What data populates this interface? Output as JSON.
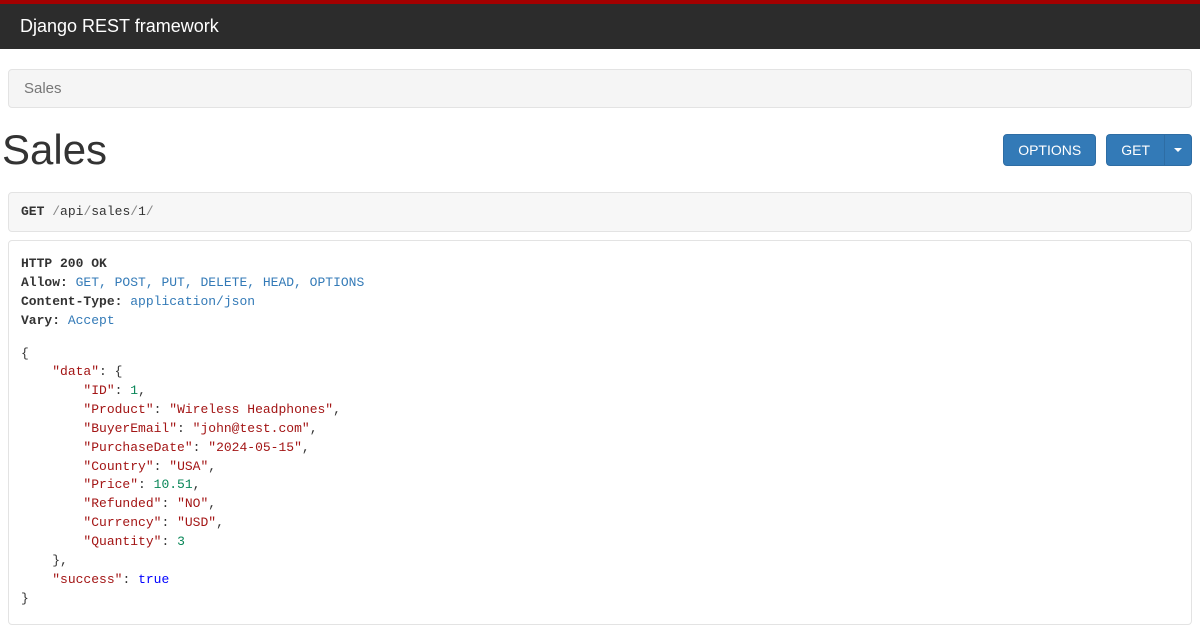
{
  "navbar": {
    "brand": "Django REST framework"
  },
  "breadcrumb": {
    "items": [
      "Sales"
    ]
  },
  "page": {
    "title": "Sales"
  },
  "buttons": {
    "options": "OPTIONS",
    "get": "GET"
  },
  "request": {
    "method": "GET",
    "path_segments": [
      "api",
      "sales",
      "1"
    ]
  },
  "response": {
    "status_line": "HTTP 200 OK",
    "headers": {
      "Allow": "GET, POST, PUT, DELETE, HEAD, OPTIONS",
      "Content-Type": "application/json",
      "Vary": "Accept"
    },
    "body": {
      "data": {
        "ID": 1,
        "Product": "Wireless Headphones",
        "BuyerEmail": "john@test.com",
        "PurchaseDate": "2024-05-15",
        "Country": "USA",
        "Price": 10.51,
        "Refunded": "NO",
        "Currency": "USD",
        "Quantity": 3
      },
      "success": true
    }
  }
}
